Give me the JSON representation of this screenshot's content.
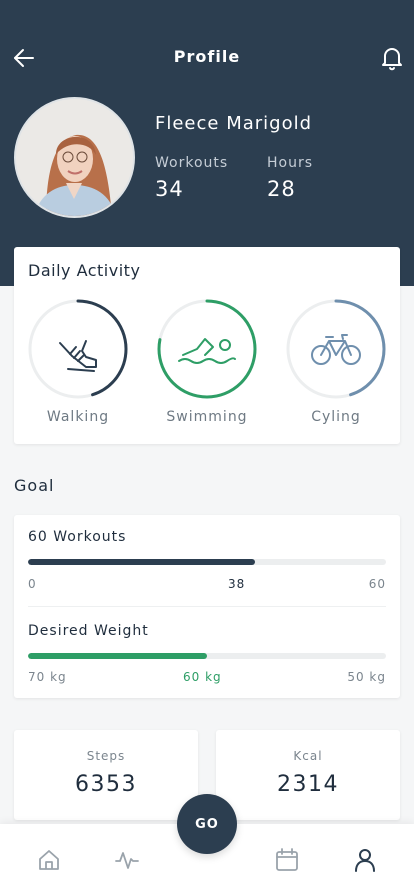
{
  "header": {
    "title": "Profile",
    "back_icon": "arrow-left-icon",
    "notification_icon": "bell-icon"
  },
  "profile": {
    "name": "Fleece Marigold",
    "stats": [
      {
        "label": "Workouts",
        "value": "34"
      },
      {
        "label": "Hours",
        "value": "28"
      }
    ]
  },
  "daily_activity": {
    "title": "Daily Activity",
    "items": [
      {
        "label": "Walking",
        "icon": "shoe-icon",
        "color": "#2c3e50",
        "progress": 0.45
      },
      {
        "label": "Swimming",
        "icon": "swimmer-icon",
        "color": "#2e9e66",
        "progress": 0.78
      },
      {
        "label": "Cyling",
        "icon": "bicycle-icon",
        "color": "#6f8fad",
        "progress": 0.45
      }
    ]
  },
  "goal": {
    "title": "Goal",
    "items": [
      {
        "name": "60 Workouts",
        "min": "0",
        "current": "38",
        "max": "60",
        "progress": 0.633,
        "color": "#2c3e50",
        "current_color": "#1f2d3d"
      },
      {
        "name": "Desired Weight",
        "min": "70 kg",
        "current": "60 kg",
        "max": "50 kg",
        "progress": 0.5,
        "color": "#2e9e66",
        "current_color": "#2e9e66"
      }
    ]
  },
  "metrics": [
    {
      "label": "Steps",
      "value": "6353"
    },
    {
      "label": "Kcal",
      "value": "2314"
    }
  ],
  "bottom_nav": {
    "go_label": "GO",
    "items": [
      "home-icon",
      "activity-icon",
      "calendar-icon",
      "user-icon"
    ],
    "active": "user-icon"
  },
  "colors": {
    "primary": "#2c3e50",
    "accent_green": "#2e9e66",
    "accent_blue": "#6f8fad"
  }
}
